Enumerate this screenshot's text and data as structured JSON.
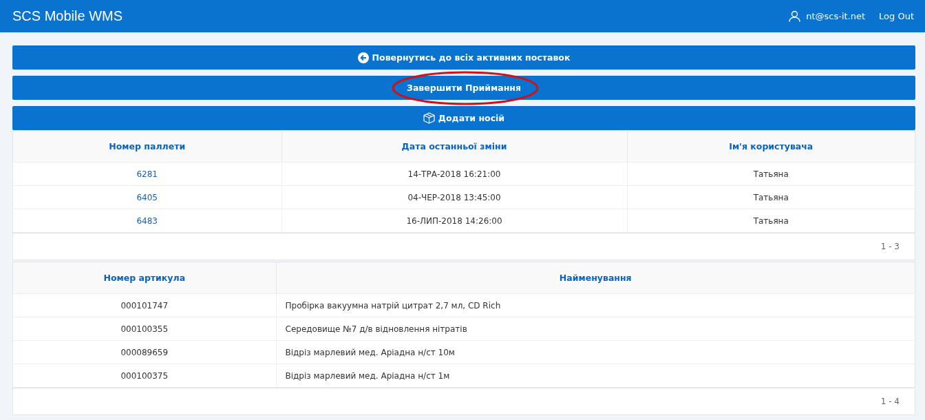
{
  "navbar": {
    "brand": "SCS Mobile WMS",
    "user": "nt@scs-it.net",
    "logout": "Log Out"
  },
  "actions": [
    {
      "kind": "back",
      "label": "Повернутись до всіх активних поставок",
      "highlighted": false
    },
    {
      "kind": "plain",
      "label": "Завершити Приймання",
      "highlighted": true
    },
    {
      "kind": "box",
      "label": "Додати носій",
      "highlighted": false
    }
  ],
  "pallets_table": {
    "columns": [
      "Номер паллети",
      "Дата останньої зміни",
      "Ім'я користувача"
    ],
    "rows": [
      [
        "6281",
        "14-ТРА-2018 16:21:00",
        "Татьяна"
      ],
      [
        "6405",
        "04-ЧЕР-2018 13:45:00",
        "Татьяна"
      ],
      [
        "6483",
        "16-ЛИП-2018 14:26:00",
        "Татьяна"
      ]
    ],
    "pager": "1 - 3"
  },
  "items_table": {
    "columns": [
      "Номер артикула",
      "Найменування"
    ],
    "rows": [
      [
        "000101747",
        "Пробірка вакуумна натрій цитрат 2,7 мл, CD Rich"
      ],
      [
        "000100355",
        "Середовище №7 д/в відновлення нітратів"
      ],
      [
        "000089659",
        "Відріз марлевий мед. Аріадна н/ст 10м"
      ],
      [
        "000100375",
        "Відріз марлевий мед. Аріадна н/ст 1м"
      ]
    ],
    "pager": "1 - 4"
  }
}
